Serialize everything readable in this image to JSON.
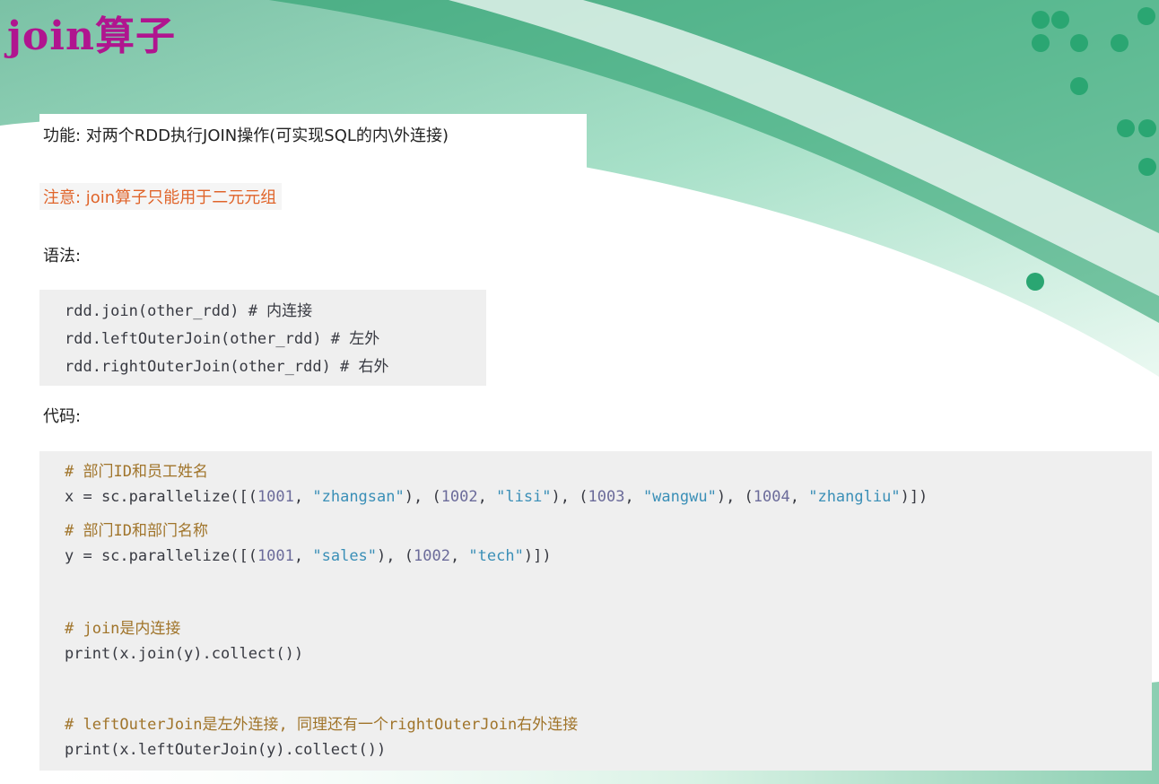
{
  "slide": {
    "title": "join算子",
    "function_line": "功能: 对两个RDD执行JOIN操作(可实现SQL的内\\外连接)",
    "note_line": "注意: join算子只能用于二元元组",
    "syntax_label": "语法:",
    "code_label": "代码:"
  },
  "syntax_code": [
    "rdd.join(other_rdd) # 内连接",
    "rdd.leftOuterJoin(other_rdd) # 左外",
    "rdd.rightOuterJoin(other_rdd) # 右外"
  ],
  "main_code": {
    "l1": "# 部门ID和员工姓名",
    "l2_prefix": "x = sc.parallelize([(",
    "l2_n1": "1001",
    "l2_s1": "\"zhangsan\"",
    "l2_n2": "1002",
    "l2_s2": "\"lisi\"",
    "l2_n3": "1003",
    "l2_s3": "\"wangwu\"",
    "l2_n4": "1004",
    "l2_s4": "\"zhangliu\"",
    "l3": "# 部门ID和部门名称",
    "l4_prefix": "y = sc.parallelize([(",
    "l4_n1": "1001",
    "l4_s1": "\"sales\"",
    "l4_n2": "1002",
    "l4_s2": "\"tech\"",
    "l5": "# join是内连接",
    "l6": "print(x.join(y).collect())",
    "l7": "# leftOuterJoin是左外连接, 同理还有一个rightOuterJoin右外连接",
    "l8": "print(x.leftOuterJoin(y).collect())"
  },
  "colors": {
    "title": "#b0158f",
    "note": "#e0642a",
    "code_bg": "#efefef",
    "accent_green": "#2aa672"
  }
}
